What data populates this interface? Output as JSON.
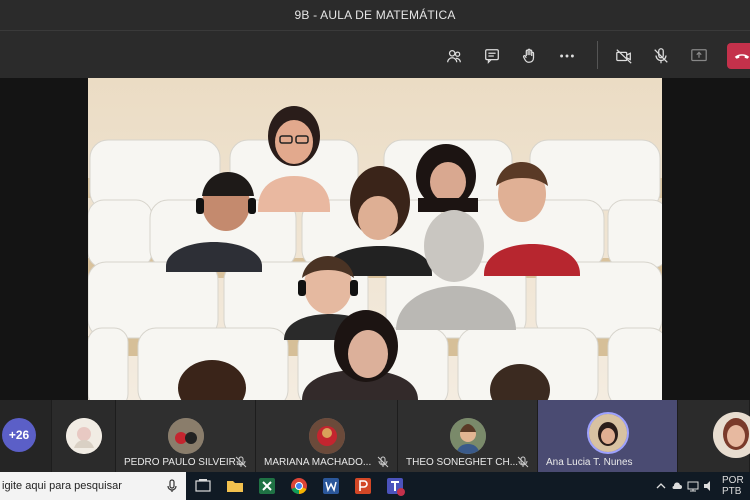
{
  "window": {
    "title": "9B - AULA DE MATEMÁTICA"
  },
  "toolbar": {
    "buttons": [
      "people-icon",
      "chat-icon",
      "raise-hand-icon",
      "more-icon",
      "camera-off-icon",
      "mic-off-icon",
      "share-screen-icon",
      "hang-up-icon"
    ]
  },
  "roster": {
    "more_count": "+26",
    "participants": [
      {
        "name": "PEDRO PAULO SILVEIR..."
      },
      {
        "name": "MARIANA MACHADO..."
      },
      {
        "name": "THEO SONEGHET CH..."
      },
      {
        "name": "Ana Lucia T. Nunes"
      }
    ]
  },
  "taskbar": {
    "search_placeholder": "igite aqui para pesquisar",
    "lang_top": "POR",
    "lang_bottom": "PTB"
  },
  "colors": {
    "accent": "#5b5fc7",
    "hangup": "#c4314b",
    "background": "#1f1f1f"
  }
}
